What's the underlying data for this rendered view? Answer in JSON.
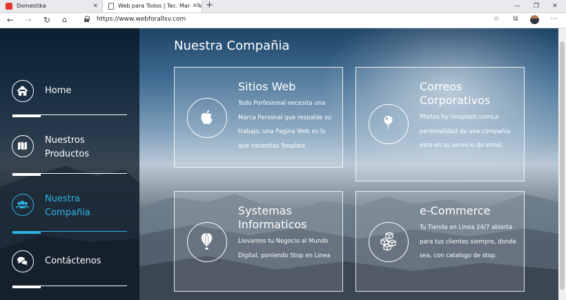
{
  "browser": {
    "tabs": [
      {
        "label": "Domestika",
        "icon": "domestika-icon"
      },
      {
        "label": "Web para Todos | Tec. Mario Rob",
        "icon": "page-icon"
      }
    ],
    "url": "https://www.webforallsv.com"
  },
  "page": {
    "heading": "Nuestra Compañia",
    "nav": [
      {
        "label": "Home",
        "icon": "home-icon",
        "active": false
      },
      {
        "label": "Nuestros\nProductos",
        "icon": "map-icon",
        "active": false
      },
      {
        "label": "Nuestra\nCompañia",
        "icon": "users-icon",
        "active": true
      },
      {
        "label": "Contáctenos",
        "icon": "chat-icon",
        "active": false
      }
    ],
    "cards": [
      {
        "title": "Sitios Web",
        "desc": "Todo Porfesional necesita una Marca Personal que respalde su trabajo, una Pagina Web es lo que necesitas Tooplate",
        "icon": "apple-icon"
      },
      {
        "title": "Correos Corporativos",
        "desc": "Photos by Unsplash.comLa personalidad de una compañia esta en su servicio de email.",
        "icon": "pin-icon"
      },
      {
        "title": "Systemas Informaticos",
        "desc": "Llevamos tu Negocio al Mundo Digital, poniendo Stop en Linea",
        "icon": "balloon-icon"
      },
      {
        "title": "e-Commerce",
        "desc": "Tu Tienda en Linea 24/7 abierta para tus clientes siempre, donde sea, con catalogo de stop.",
        "icon": "cubes-icon"
      }
    ]
  },
  "colors": {
    "accent": "#2fb3e6",
    "sidebar": "#05121e"
  }
}
